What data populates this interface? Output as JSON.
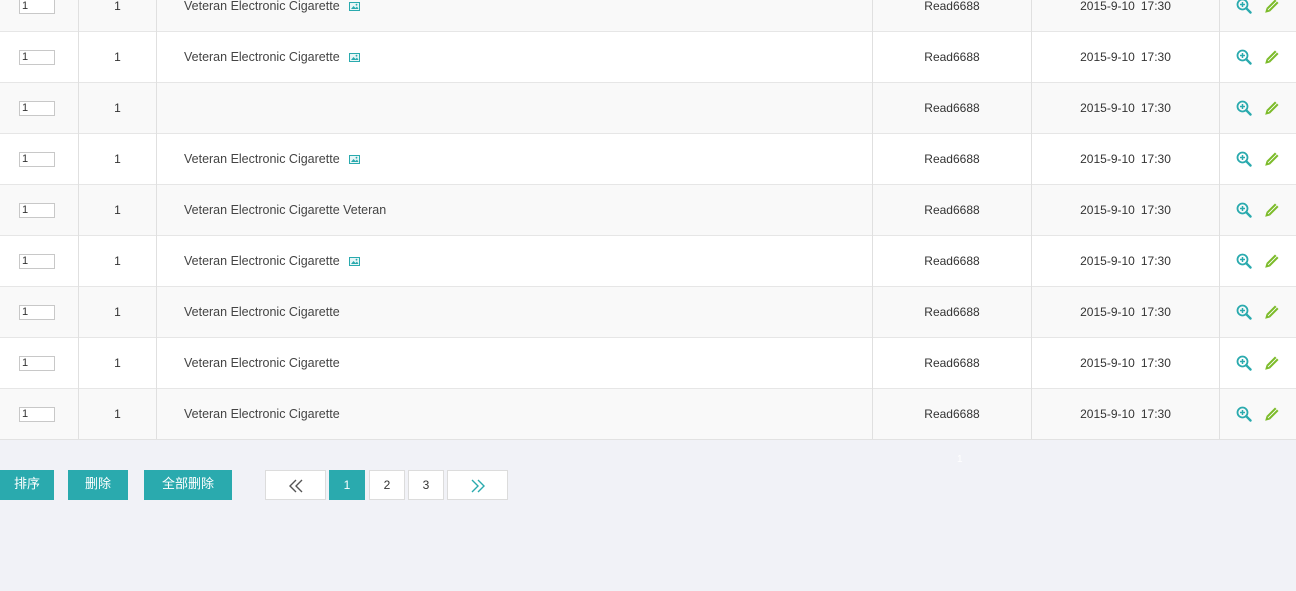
{
  "rows": [
    {
      "sort": "1",
      "id": "1",
      "title": "Veteran Electronic Cigarette",
      "has_image": true,
      "user": "Read6688",
      "date": "2015-9-10",
      "time": "17:30"
    },
    {
      "sort": "1",
      "id": "1",
      "title": "Veteran Electronic Cigarette",
      "has_image": true,
      "user": "Read6688",
      "date": "2015-9-10",
      "time": "17:30"
    },
    {
      "sort": "1",
      "id": "1",
      "title": "",
      "has_image": false,
      "user": "Read6688",
      "date": "2015-9-10",
      "time": "17:30"
    },
    {
      "sort": "1",
      "id": "1",
      "title": "Veteran Electronic Cigarette",
      "has_image": true,
      "user": "Read6688",
      "date": "2015-9-10",
      "time": "17:30"
    },
    {
      "sort": "1",
      "id": "1",
      "title": "Veteran Electronic Cigarette Veteran",
      "has_image": false,
      "user": "Read6688",
      "date": "2015-9-10",
      "time": "17:30"
    },
    {
      "sort": "1",
      "id": "1",
      "title": "Veteran Electronic Cigarette",
      "has_image": true,
      "user": "Read6688",
      "date": "2015-9-10",
      "time": "17:30"
    },
    {
      "sort": "1",
      "id": "1",
      "title": "Veteran Electronic Cigarette",
      "has_image": false,
      "user": "Read6688",
      "date": "2015-9-10",
      "time": "17:30"
    },
    {
      "sort": "1",
      "id": "1",
      "title": "Veteran Electronic Cigarette",
      "has_image": false,
      "user": "Read6688",
      "date": "2015-9-10",
      "time": "17:30"
    },
    {
      "sort": "1",
      "id": "1",
      "title": "Veteran Electronic Cigarette",
      "has_image": false,
      "user": "Read6688",
      "date": "2015-9-10",
      "time": "17:30"
    }
  ],
  "row_icons": {
    "image": "image-icon",
    "view": "zoom-in-icon",
    "edit": "pencil-icon"
  },
  "actions": {
    "sort_label": "排序",
    "delete_label": "删除",
    "delete_all_label": "全部删除"
  },
  "pagination": {
    "first_icon": "double-chevron-left-icon",
    "pages": [
      "1",
      "2",
      "3"
    ],
    "current": "1",
    "last_icon": "double-chevron-right-icon"
  },
  "faint_text": "1",
  "colors": {
    "accent": "#2aaaae",
    "edit_icon": "#7cbb2a",
    "background": "#f1f2f7"
  }
}
